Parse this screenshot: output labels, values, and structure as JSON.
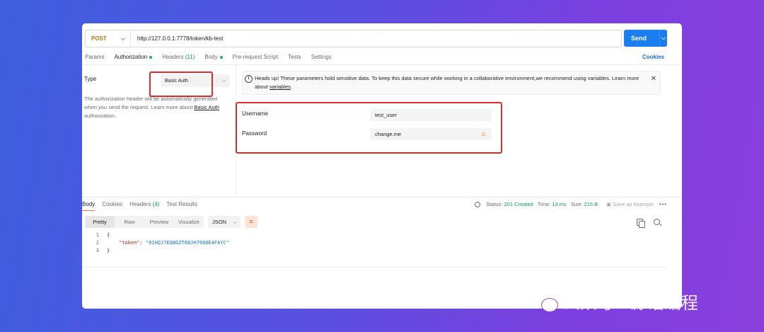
{
  "request": {
    "method": "POST",
    "url": "http://127.0.0.1:7778/token/kb-test",
    "send_label": "Send"
  },
  "tabs": [
    {
      "label": "Params"
    },
    {
      "label": "Authorization"
    },
    {
      "label": "Headers",
      "count": "(11)"
    },
    {
      "label": "Body"
    },
    {
      "label": "Pre-request Script"
    },
    {
      "label": "Tests"
    },
    {
      "label": "Settings"
    }
  ],
  "cookies_label": "Cookies",
  "auth": {
    "type_label": "Type",
    "type_value": "Basic Auth",
    "description": "The authorization header will be automatically generated when you send the request. Learn more about ",
    "description_link": "Basic Auth",
    "description_end": " authorization.",
    "alert_text": "Heads up! These parameters hold sensitive data. To keep this data secure while working in a collaborative environment,we recommend using variables. Learn more about ",
    "alert_link": "variables",
    "alert_end": ".",
    "username_label": "Username",
    "username_value": "test_user",
    "password_label": "Password",
    "password_value": "change.me"
  },
  "response": {
    "tabs": [
      {
        "label": "Body"
      },
      {
        "label": "Cookies"
      },
      {
        "label": "Headers",
        "count": "(4)"
      },
      {
        "label": "Test Results"
      }
    ],
    "status_label": "Status:",
    "status_value": "201 Created",
    "time_label": "Time:",
    "time_value": "13 ms",
    "size_label": "Size:",
    "size_value": "215 B",
    "save_example": "Save as example",
    "views": [
      "Pretty",
      "Raw",
      "Preview",
      "Visualize"
    ],
    "format": "JSON",
    "lines": [
      "1",
      "2",
      "3"
    ],
    "code_open": "{",
    "code_key": "\"token\"",
    "code_colon": ": ",
    "code_value": "\"01HQJ7EQBDZT88JH798DE4FAYC\"",
    "code_close": "}"
  },
  "watermark": "公众号 · 源话编程",
  "colors": {
    "accent": "#ff6c37",
    "send": "#1a7eee",
    "highlight": "#e02b2b",
    "success": "#0aa64a"
  }
}
